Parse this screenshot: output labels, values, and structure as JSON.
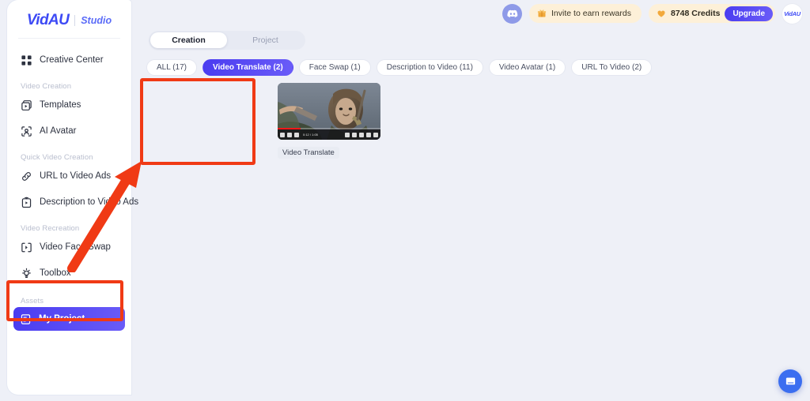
{
  "brand": {
    "name": "VidAU",
    "suffix": "Studio"
  },
  "topbar": {
    "discord_icon": "discord-icon",
    "invite_label": "Invite to earn rewards",
    "invite_icon": "gift-icon",
    "credits_label": "8748 Credits",
    "credits_icon": "diamond-icon",
    "upgrade_label": "Upgrade",
    "avatar_label": "VidAU"
  },
  "sidebar": {
    "top_item": {
      "label": "Creative Center",
      "icon": "grid-icon"
    },
    "sections": [
      {
        "title": "Video Creation",
        "items": [
          {
            "label": "Templates",
            "icon": "templates-icon"
          },
          {
            "label": "AI Avatar",
            "icon": "avatar-scan-icon"
          }
        ]
      },
      {
        "title": "Quick Video Creation",
        "items": [
          {
            "label": "URL to Video Ads",
            "icon": "link-icon"
          },
          {
            "label": "Description to Video Ads",
            "icon": "document-video-icon"
          }
        ]
      },
      {
        "title": "Video Recreation",
        "items": [
          {
            "label": "Video Face Swap",
            "icon": "face-swap-icon"
          },
          {
            "label": "Toolbox",
            "icon": "bulb-icon"
          }
        ]
      },
      {
        "title": "Assets",
        "items": [
          {
            "label": "My Project",
            "icon": "project-icon",
            "active": true
          }
        ]
      }
    ]
  },
  "main": {
    "tabs": [
      {
        "label": "Creation",
        "active": true
      },
      {
        "label": "Project",
        "active": false
      }
    ],
    "filters": [
      {
        "label": "ALL (17)",
        "active": false
      },
      {
        "label": "Video Translate (2)",
        "active": true
      },
      {
        "label": "Face Swap (1)",
        "active": false
      },
      {
        "label": "Description to Video (11)",
        "active": false
      },
      {
        "label": "Video Avatar (1)",
        "active": false
      },
      {
        "label": "URL To Video (2)",
        "active": false
      }
    ],
    "cards": [
      {
        "label": "Video Translate",
        "duration": "0:12 / 1:05"
      }
    ]
  },
  "chat": {
    "icon": "chat-bubble-icon"
  },
  "colors": {
    "accent": "#4a3cf0",
    "highlight": "#f03a15",
    "page_bg": "#eef0f7",
    "pill_bg": "#fdf0d8"
  }
}
